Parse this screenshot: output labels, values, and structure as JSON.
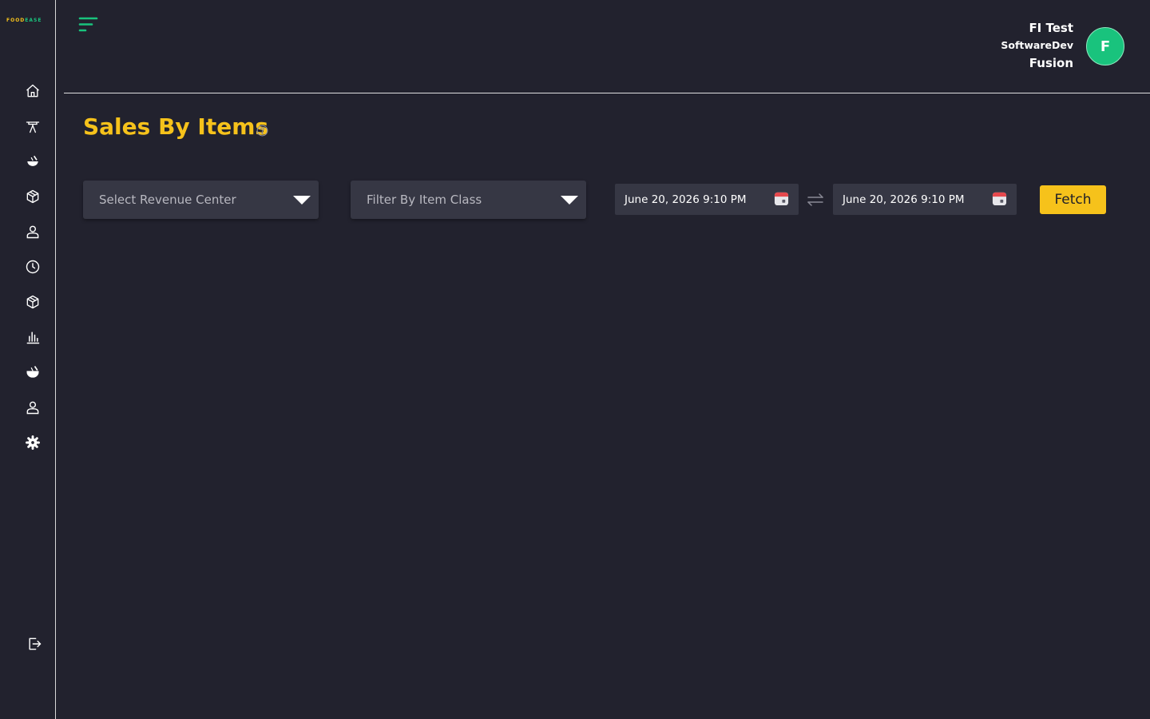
{
  "brand": {
    "logo_part1": "FOOD",
    "logo_part2": "EASE"
  },
  "sidebar": {
    "items": [
      {
        "icon": "home-icon"
      },
      {
        "icon": "dining-table-icon"
      },
      {
        "icon": "food-icon"
      },
      {
        "icon": "box-icon"
      },
      {
        "icon": "user-icon"
      },
      {
        "icon": "clock-icon"
      },
      {
        "icon": "package-icon"
      },
      {
        "icon": "bar-chart-icon"
      },
      {
        "icon": "food-filled-icon"
      },
      {
        "icon": "user-icon"
      },
      {
        "icon": "settings-icon"
      }
    ],
    "logout_icon": "logout-icon"
  },
  "user": {
    "name": "FI Test",
    "org_line1": "SoftwareDev",
    "org_line2": "Fusion",
    "avatar_initial": "F"
  },
  "page": {
    "title": "Sales By Items"
  },
  "filters": {
    "revenue_center_placeholder": "Select Revenue Center",
    "item_class_placeholder": "Filter By Item Class",
    "start_date": "June 20, 2026 9:10 PM",
    "end_date": "June 20, 2026 9:10 PM",
    "fetch_label": "Fetch"
  },
  "colors": {
    "background": "#22222e",
    "accent_yellow": "#f6c21b",
    "accent_green": "#19c37d",
    "field_bg": "#363744"
  }
}
